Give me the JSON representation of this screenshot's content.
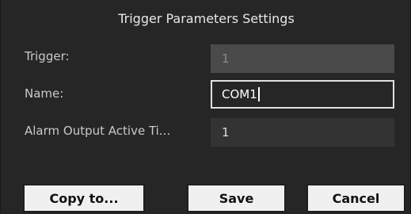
{
  "dialog": {
    "title": "Trigger Parameters Settings"
  },
  "fields": {
    "trigger": {
      "label": "Trigger:",
      "value": "1"
    },
    "name": {
      "label": "Name:",
      "value": "COM1"
    },
    "alarm_output_active_time": {
      "label": "Alarm Output Active Ti...",
      "value": "1"
    }
  },
  "buttons": {
    "copy_to": "Copy to...",
    "save": "Save",
    "cancel": "Cancel"
  }
}
